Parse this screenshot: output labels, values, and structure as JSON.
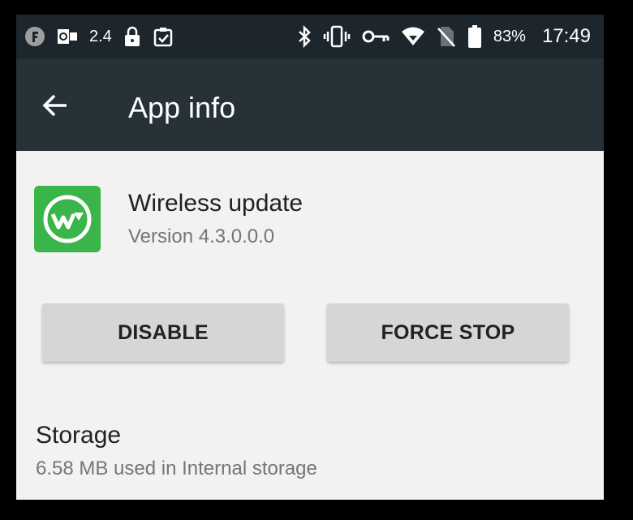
{
  "status_bar": {
    "left_icons": [
      "firefox-icon",
      "outlook-icon",
      "network-speed-icon",
      "lock-icon",
      "clipboard-check-icon"
    ],
    "network_speed": "2.4",
    "right_icons": [
      "bluetooth-icon",
      "vibrate-icon",
      "vpn-key-icon",
      "wifi-icon",
      "no-sim-icon",
      "battery-icon"
    ],
    "battery_percent": "83%",
    "time": "17:49"
  },
  "app_bar": {
    "title": "App info",
    "back_icon": "arrow-back-icon"
  },
  "app": {
    "name": "Wireless update",
    "version": "Version 4.3.0.0.0",
    "icon": "wireless-update-logo",
    "icon_color": "#3ab54a"
  },
  "buttons": {
    "disable": "DISABLE",
    "force_stop": "FORCE STOP"
  },
  "storage": {
    "title": "Storage",
    "summary": "6.58 MB used in Internal storage"
  },
  "colors": {
    "status_bar": "#1c262c",
    "app_bar": "#263238",
    "background": "#f2f2f2",
    "button": "#d6d6d6"
  }
}
